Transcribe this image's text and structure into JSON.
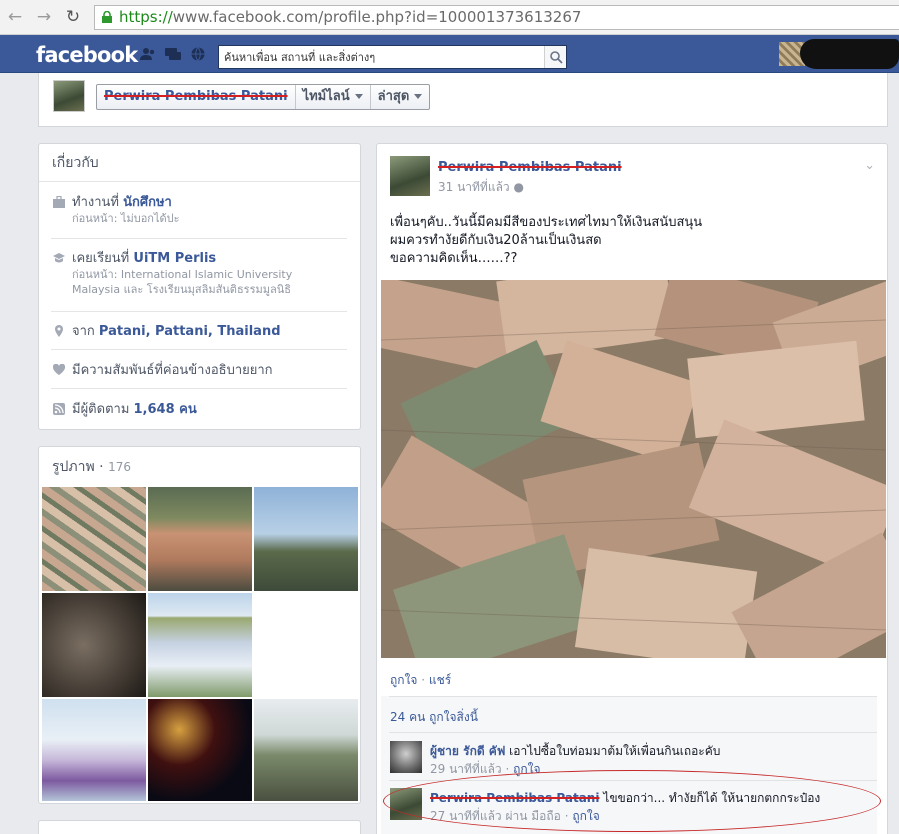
{
  "browser": {
    "url_scheme": "https://",
    "url_rest": "www.facebook.com/profile.php?id=100001373613267"
  },
  "fb": {
    "logo": "facebook",
    "search_placeholder": "ค้นหาเพื่อน สถานที่ และสิ่งต่างๆ"
  },
  "timeline": {
    "name": "Perwira Pembibas Patani",
    "tab1": "ไทม์ไลน์",
    "tab2": "ล่าสุด"
  },
  "about": {
    "title": "เกี่ยวกับ",
    "work_prefix": "ทำงานที่ ",
    "work_place": "นักศึกษา",
    "work_past": "ก่อนหน้า: ไม่บอกได้ปะ",
    "edu_prefix": "เคยเรียนที่ ",
    "edu_place": "UiTM Perlis",
    "edu_past_1": "ก่อนหน้า: International Islamic University",
    "edu_past_2": "Malaysia และ โรงเรียนมุสลิมสันติธรรมมูลนิธิ",
    "from_prefix": "จาก ",
    "from_place": "Patani, Pattani, Thailand",
    "relationship": "มีความสัมพันธ์ที่ค่อนข้างอธิบายยาก",
    "followers_prefix": "มีผู้ติดตาม ",
    "followers_count": "1,648 คน"
  },
  "photos": {
    "title": "รูปภาพ",
    "count": "176"
  },
  "post": {
    "author": "Perwira Pembibas Patani",
    "time": "31 นาทีที่แล้ว",
    "lines": [
      "เพื่อนๆคับ..วันนี้มีคมมีสีของประเทศไทมาให้เงินสนับสนุน",
      "ผมควรทำงัยดีกับเงิน20ล้านเป็นเงินสด",
      "ขอความคิดเห็น……??"
    ],
    "like_label": "ถูกใจ",
    "share_label": "แชร์",
    "likes_summary": "24 คน ถูกใจสิ่งนี้"
  },
  "comments": [
    {
      "author": "ผู้ชาย รักดี คัฟ",
      "text": "เอาไปซื้อใบท่อมมาต้มให้เพื่อนกินเถอะคับ",
      "time": "29 นาทีที่แล้ว",
      "like": "ถูกใจ"
    },
    {
      "author": "Perwira Pembibas Patani",
      "text": "ไขขอกว่า... ทำงัยก็ได้ ให้นายกตกกระป๋อง",
      "time": "27 นาทีที่แล้ว ผ่าน มือถือ",
      "like": "ถูกใจ"
    }
  ],
  "colors": {
    "fb_blue": "#3b5998",
    "link": "#3b5998",
    "strike": "#d42020",
    "annotation": "#c62a2a"
  }
}
